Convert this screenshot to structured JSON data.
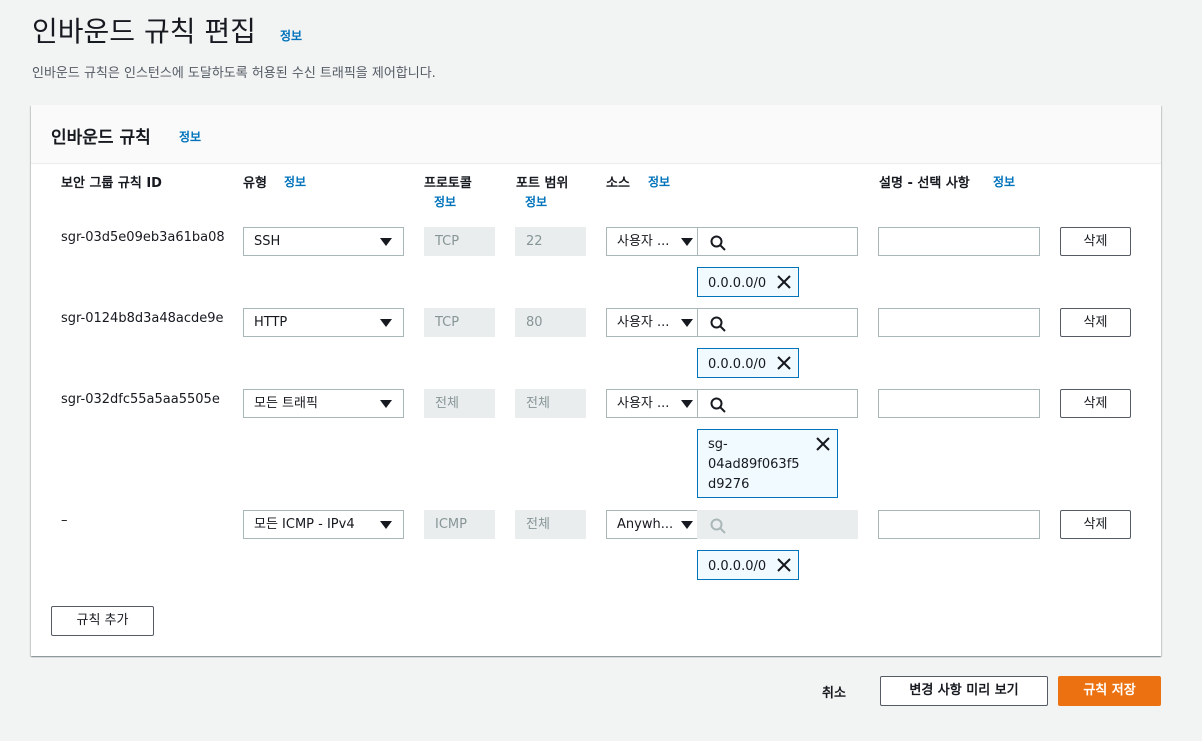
{
  "page": {
    "title": "인바운드 규칙 편집",
    "info": "정보",
    "description": "인바운드 규칙은 인스턴스에 도달하도록 허용된 수신 트래픽을 제어합니다."
  },
  "panel": {
    "title": "인바운드 규칙",
    "info": "정보"
  },
  "columns": {
    "rule_id": "보안 그룹 규칙 ID",
    "type": "유형",
    "type_info": "정보",
    "protocol": "프로토콜",
    "protocol_info": "정보",
    "port_range": "포트 범위",
    "port_info": "정보",
    "source": "소스",
    "source_info": "정보",
    "description": "설명 - 선택 사항",
    "description_info": "정보"
  },
  "rules": [
    {
      "id": "sgr-03d5e09eb3a61ba08",
      "type": "SSH",
      "protocol": "TCP",
      "port": "22",
      "source_type": "사용자 ...",
      "tokens": [
        "0.0.0.0/0"
      ],
      "delete": "삭제"
    },
    {
      "id": "sgr-0124b8d3a48acde9e",
      "type": "HTTP",
      "protocol": "TCP",
      "port": "80",
      "source_type": "사용자 ...",
      "tokens": [
        "0.0.0.0/0"
      ],
      "delete": "삭제"
    },
    {
      "id": "sgr-032dfc55a5aa5505e",
      "type": "모든 트래픽",
      "protocol": "전체",
      "port": "전체",
      "source_type": "사용자 ...",
      "tokens": [
        "sg-04ad89f063f5d9276"
      ],
      "token_lines": [
        "sg-",
        "04ad89f063f5",
        "d9276"
      ],
      "delete": "삭제"
    },
    {
      "id": "–",
      "type": "모든 ICMP - IPv4",
      "protocol": "ICMP",
      "port": "전체",
      "source_type": "Anywh...",
      "tokens": [
        "0.0.0.0/0"
      ],
      "delete": "삭제"
    }
  ],
  "add_rule": "규칙 추가",
  "footer": {
    "cancel": "취소",
    "preview": "변경 사항 미리 보기",
    "save": "규칙 저장"
  },
  "colors": {
    "link": "#0073bb",
    "primary": "#ec7211",
    "background": "#f2f3f3"
  }
}
